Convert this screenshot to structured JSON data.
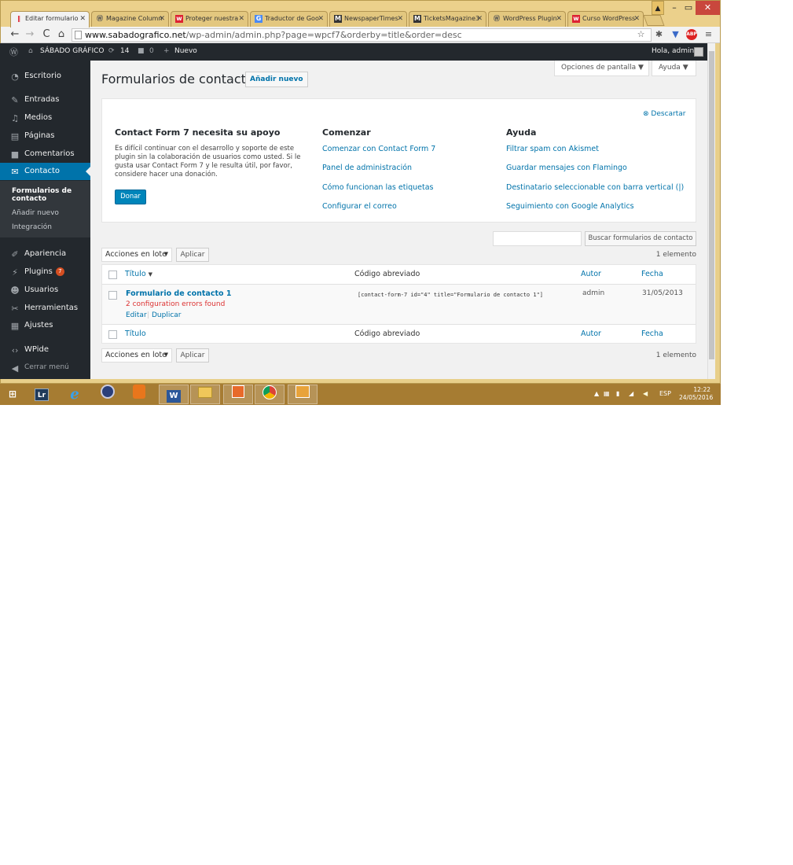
{
  "browser": {
    "tabs": [
      {
        "title": "Editar formulario",
        "favicon": "contact-form-icon"
      },
      {
        "title": "Magazine Column",
        "favicon": "wordpress-icon"
      },
      {
        "title": "Proteger nuestra",
        "favicon": "w-icon"
      },
      {
        "title": "Traductor de Goo",
        "favicon": "translate-icon"
      },
      {
        "title": "NewspaperTimes",
        "favicon": "m-icon"
      },
      {
        "title": "TicketsMagazine3",
        "favicon": "m-icon"
      },
      {
        "title": "WordPress Plugin",
        "favicon": "wordpress-icon"
      },
      {
        "title": "Curso WordPress",
        "favicon": "w-icon"
      }
    ],
    "url_host": "www.sabadografico.net",
    "url_path": "/wp-admin/admin.php?page=wpcf7&orderby=title&order=desc",
    "abp_label": "ABP"
  },
  "adminbar": {
    "site_name": "SÁBADO GRÁFICO",
    "updates_count": "14",
    "comments_count": "0",
    "new_label": "Nuevo",
    "greeting": "Hola, admin"
  },
  "sidebar": {
    "items": [
      {
        "label": "Escritorio",
        "icon": "dashboard-icon"
      },
      {
        "label": "Entradas",
        "icon": "pin-icon"
      },
      {
        "label": "Medios",
        "icon": "media-icon"
      },
      {
        "label": "Páginas",
        "icon": "pages-icon"
      },
      {
        "label": "Comentarios",
        "icon": "comments-icon"
      },
      {
        "label": "Contacto",
        "icon": "mail-icon"
      },
      {
        "label": "Apariencia",
        "icon": "brush-icon"
      },
      {
        "label": "Plugins",
        "icon": "plugin-icon"
      },
      {
        "label": "Usuarios",
        "icon": "users-icon"
      },
      {
        "label": "Herramientas",
        "icon": "tools-icon"
      },
      {
        "label": "Ajustes",
        "icon": "settings-icon"
      },
      {
        "label": "WPide",
        "icon": "code-icon"
      },
      {
        "label": "Cerrar menú",
        "icon": "collapse-icon"
      }
    ],
    "submenu": [
      "Formularios de contacto",
      "Añadir nuevo",
      "Integración"
    ],
    "plugins_badge": "7"
  },
  "header": {
    "screen_options": "Opciones de pantalla",
    "help": "Ayuda",
    "title": "Formularios de contacto",
    "add_new": "Añadir nuevo"
  },
  "welcome": {
    "dismiss": "Descartar",
    "support_heading": "Contact Form 7 necesita su apoyo",
    "support_text": "Es difícil continuar con el desarrollo y soporte de este plugin sin la colaboración de usuarios como usted. Si le gusta usar Contact Form 7 y le resulta útil, por favor, considere hacer una donación.",
    "donate": "Donar",
    "start_heading": "Comenzar",
    "start_links": [
      "Comenzar con Contact Form 7",
      "Panel de administración",
      "Cómo funcionan las etiquetas",
      "Configurar el correo"
    ],
    "help_heading": "Ayuda",
    "help_links": [
      "Filtrar spam con Akismet",
      "Guardar mensajes con Flamingo",
      "Destinatario seleccionable con barra vertical (|)",
      "Seguimiento con Google Analytics"
    ]
  },
  "list": {
    "search_button": "Buscar formularios de contacto",
    "bulk_actions": "Acciones en lote",
    "apply": "Aplicar",
    "count": "1 elemento",
    "columns": {
      "title": "Título",
      "shortcode": "Código abreviado",
      "author": "Autor",
      "date": "Fecha"
    },
    "rows": [
      {
        "title": "Formulario de contacto 1",
        "errors": "2 configuration errors found",
        "edit": "Editar",
        "duplicate": "Duplicar",
        "shortcode": "[contact-form-7 id=\"4\" title=\"Formulario de contacto 1\"]",
        "author": "admin",
        "date": "31/05/2013"
      }
    ]
  },
  "taskbar": {
    "apps": [
      "windows-start-icon",
      "lightroom-icon",
      "internet-explorer-icon",
      "app-icon",
      "office-icon",
      "word-icon",
      "file-explorer-icon",
      "paint-icon",
      "chrome-icon",
      "outlook-icon"
    ],
    "lang": "ESP",
    "time": "12:22",
    "date": "24/05/2016"
  },
  "colors": {
    "wp_blue": "#0073aa",
    "admin_bar": "#23282d",
    "error_red": "#dc3232",
    "taskbar": "#a67c32"
  }
}
